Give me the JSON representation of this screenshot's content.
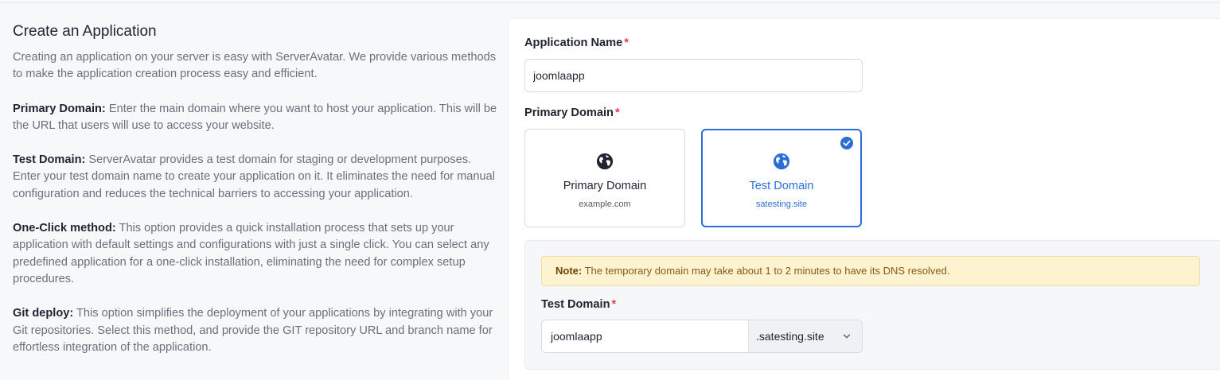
{
  "info": {
    "title": "Create an Application",
    "intro": "Creating an application on your server is easy with ServerAvatar. We provide various methods to make the application creation process easy and efficient.",
    "sections": [
      {
        "term": "Primary Domain:",
        "text": " Enter the main domain where you want to host your application. This will be the URL that users will use to access your website."
      },
      {
        "term": "Test Domain:",
        "text": " ServerAvatar provides a test domain for staging or development purposes. Enter your test domain name to create your application on it. It eliminates the need for manual configuration and reduces the technical barriers to accessing your application."
      },
      {
        "term": "One-Click method:",
        "text": " This option provides a quick installation process that sets up your application with default settings and configurations with just a single click. You can select any predefined application for a one-click installation, eliminating the need for complex setup procedures."
      },
      {
        "term": "Git deploy:",
        "text": " This option simplifies the deployment of your applications by integrating with your Git repositories. Select this method, and provide the GIT repository URL and branch name for effortless integration of the application."
      }
    ]
  },
  "form": {
    "app_name_label": "Application Name",
    "required_mark": "*",
    "app_name_value": "joomlaapp",
    "primary_domain_label": "Primary Domain",
    "domain_options": [
      {
        "title": "Primary Domain",
        "subtitle": "example.com",
        "selected": false,
        "icon": "globe-icon"
      },
      {
        "title": "Test Domain",
        "subtitle": "satesting.site",
        "selected": true,
        "icon": "globe-icon"
      }
    ],
    "note_label": "Note:",
    "note_text": " The temporary domain may take about 1 to 2 minutes to have its DNS resolved.",
    "test_domain_label": "Test Domain",
    "test_domain_value": "joomlaapp",
    "test_domain_suffix": ".satesting.site",
    "test_domain_suffix_icon": "chevron-down-icon"
  },
  "colors": {
    "accent": "#2b6fd6",
    "required": "#e53e4d",
    "note_bg": "#fdf3d0",
    "note_text": "#8a5a12"
  }
}
